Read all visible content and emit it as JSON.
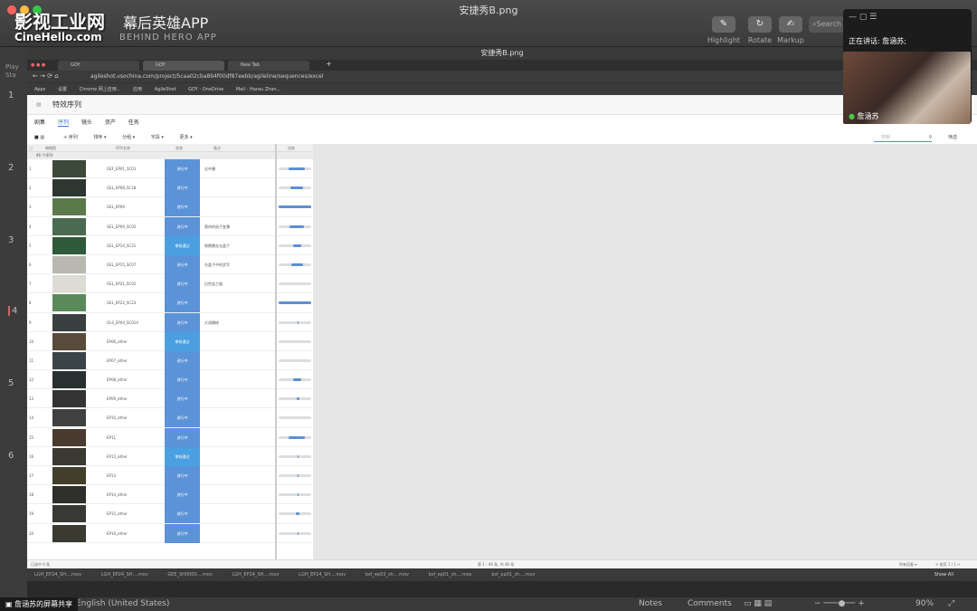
{
  "window": {
    "filename": "安捷秀B.png",
    "doc_title": "安捷秀B.png"
  },
  "watermark": {
    "brand": "影视工业网",
    "url": "CineHello.com",
    "app_title": "幕后英雄APP",
    "app_sub": "BEHIND HERO APP"
  },
  "toolbar": {
    "tools": [
      {
        "label": "Highlight",
        "icon": "✎"
      },
      {
        "label": "Rotate",
        "icon": "↻"
      },
      {
        "label": "Markup",
        "icon": "✍"
      }
    ],
    "search_placeholder": "Search"
  },
  "sidebar": {
    "play_label": "Play",
    "play_sub": "Sta",
    "pages": [
      "1",
      "2",
      "3",
      "4",
      "5",
      "6"
    ]
  },
  "meeting": {
    "speaking_label": "正在讲话: 詹涵苏;",
    "participant": "詹涵苏"
  },
  "browser": {
    "tabs": [
      "GOY",
      "GOY",
      "New Tab"
    ],
    "url": "agileshot.vsochina.com/project/5caa02cba894f00df87eebb/agileline/sequences/excel",
    "bookmarks": [
      "Apps",
      "设置",
      "Chrome 网上应用...",
      "应用",
      "AgileShot",
      "GOY - OneDrive",
      "Mail - Harau Zhan..."
    ]
  },
  "app": {
    "page_title": "特效序列",
    "nav_tabs": [
      "剧集",
      "序列",
      "镜头",
      "资产",
      "任务"
    ],
    "active_tab": "序列",
    "toolbar": [
      "+ 序列",
      "排序 ▾",
      "分组 ▾",
      "字段 ▾",
      "更多 ▾"
    ],
    "search_placeholder": "搜索",
    "filter_label": "筛选",
    "columns": [
      "缩略图",
      "序列名称",
      "状态",
      "备注",
      "进度"
    ],
    "group_label": "46 个序列",
    "rows": [
      {
        "n": "1",
        "seq": "GEF_EP01_SC01",
        "status": "进行中",
        "note": "全中播",
        "progress": 0.5
      },
      {
        "n": "2",
        "seq": "GEL_EP08_SC18",
        "status": "进行中",
        "note": "",
        "progress": 0.4
      },
      {
        "n": "3",
        "seq": "GEL_EP09",
        "status": "进行中",
        "note": "",
        "progress": 1.0
      },
      {
        "n": "4",
        "seq": "GEL_EP09_SC05",
        "status": "进行中",
        "note": "营侍的鼠子变薄",
        "progress": 0.45
      },
      {
        "n": "5",
        "seq": "GEL_EP14_SC21",
        "status": "审核通过",
        "note": "商朗播去允盖子",
        "progress": 0.25
      },
      {
        "n": "6",
        "seq": "GEL_EP15_SC07",
        "status": "进行中",
        "note": "台盖子中的武写",
        "progress": 0.35
      },
      {
        "n": "7",
        "seq": "GEL_EP21_SC02",
        "status": "进行中",
        "note": "白色连工器",
        "progress": 0.0
      },
      {
        "n": "8",
        "seq": "GEL_EP22_SC23",
        "status": "进行中",
        "note": "",
        "progress": 1.0
      },
      {
        "n": "9",
        "seq": "GLS_EP04_SC014",
        "status": "进行中",
        "note": "大润播修",
        "progress": 0.05
      },
      {
        "n": "10",
        "seq": "EP06_other",
        "status": "审核通过",
        "note": "",
        "progress": 0.0
      },
      {
        "n": "11",
        "seq": "EP07_other",
        "status": "进行中",
        "note": "",
        "progress": 0.0
      },
      {
        "n": "12",
        "seq": "EP08_other",
        "status": "进行中",
        "note": "",
        "progress": 0.25
      },
      {
        "n": "13",
        "seq": "EP09_other",
        "status": "进行中",
        "note": "",
        "progress": 0.08
      },
      {
        "n": "14",
        "seq": "EP10_other",
        "status": "进行中",
        "note": "",
        "progress": 0.0
      },
      {
        "n": "15",
        "seq": "EP11",
        "status": "进行中",
        "note": "",
        "progress": 0.5
      },
      {
        "n": "16",
        "seq": "EP12_other",
        "status": "审核通过",
        "note": "",
        "progress": 0.05
      },
      {
        "n": "17",
        "seq": "EP13",
        "status": "进行中",
        "note": "",
        "progress": 0.05
      },
      {
        "n": "18",
        "seq": "EP14_other",
        "status": "进行中",
        "note": "",
        "progress": 0.05
      },
      {
        "n": "19",
        "seq": "EP15_other",
        "status": "进行中",
        "note": "",
        "progress": 0.1
      },
      {
        "n": "20",
        "seq": "EP16_other",
        "status": "进行中",
        "note": "",
        "progress": 0.05
      }
    ],
    "footer_left": "已选中 0 条",
    "footer_mid": "第 1 - 46 条, 共 46 条",
    "footer_right": "所有回复 ▾",
    "footer_page": "< 前页 1 / 1 >"
  },
  "downloads": [
    "LGH_EP24_SH....mov",
    "LGH_EP24_SH....mov",
    "GEE_SH0000....mov",
    "LGH_EP24_SH....mov",
    "LGH_EP24_SH....mov",
    "bsf_ep03_sh....mov",
    "bsf_ep01_sh....mov",
    "bsf_ep01_sh....mov"
  ],
  "downloads_show_all": "Show All",
  "statusbar": {
    "share_label": "詹涵苏的屏幕共享",
    "language": "English (United States)",
    "notes": "Notes",
    "comments": "Comments",
    "zoom": "90%"
  }
}
